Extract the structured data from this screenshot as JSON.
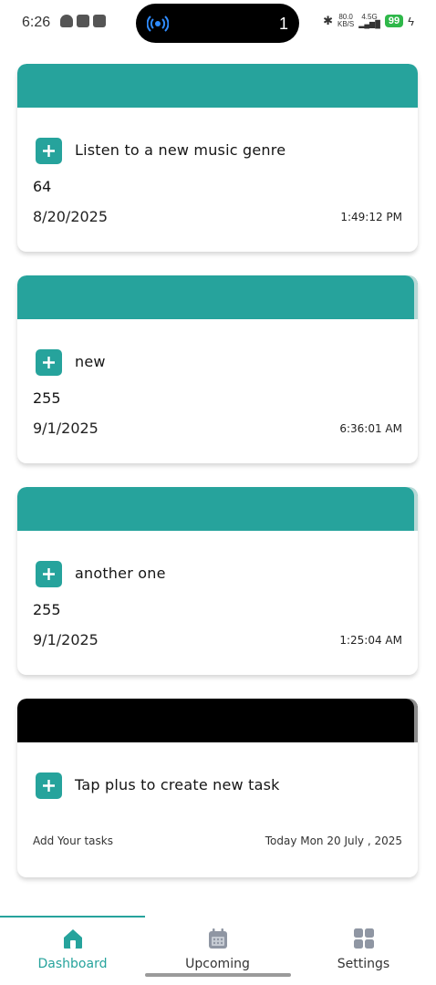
{
  "status_bar": {
    "time": "6:26",
    "island_count": "1",
    "net_speed_top": "80.0",
    "net_speed_bottom": "KB/S",
    "network": "4.5G",
    "battery": "99"
  },
  "colors": {
    "accent": "#26a39c",
    "dark_header": "#000000"
  },
  "tasks": [
    {
      "title": "Listen to a new music genre",
      "count": "64",
      "date": "8/20/2025",
      "time": "1:49:12 PM"
    },
    {
      "title": "new",
      "count": "255",
      "date": "9/1/2025",
      "time": "6:36:01 AM"
    },
    {
      "title": "another one",
      "count": "255",
      "date": "9/1/2025",
      "time": "1:25:04 AM"
    }
  ],
  "create_card": {
    "title": "Tap plus to create new task",
    "hint": "Add Your tasks",
    "today": "Today Mon 20 July , 2025"
  },
  "nav": {
    "items": [
      {
        "label": "Dashboard",
        "icon": "home-icon",
        "active": true
      },
      {
        "label": "Upcoming",
        "icon": "calendar-icon",
        "active": false
      },
      {
        "label": "Settings",
        "icon": "grid-icon",
        "active": false
      }
    ]
  }
}
